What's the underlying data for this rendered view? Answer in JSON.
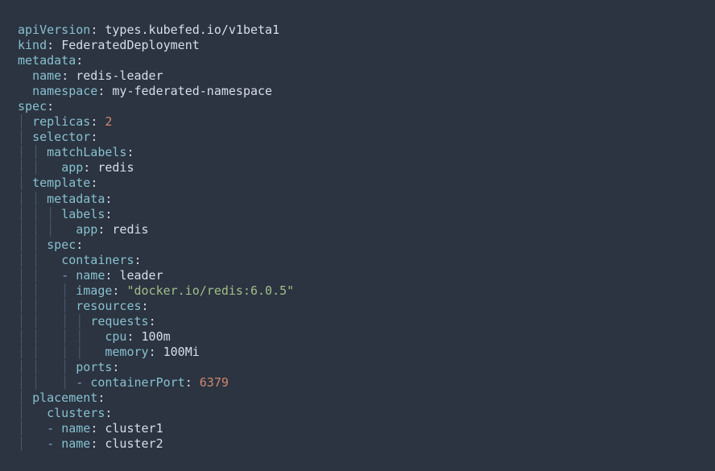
{
  "yaml": {
    "apiVersion": {
      "key": "apiVersion",
      "value": "types.kubefed.io/v1beta1"
    },
    "kind": {
      "key": "kind",
      "value": "FederatedDeployment"
    },
    "metadata": {
      "key": "metadata"
    },
    "metadata_name": {
      "key": "name",
      "value": "redis-leader"
    },
    "metadata_namespace": {
      "key": "namespace",
      "value": "my-federated-namespace"
    },
    "spec": {
      "key": "spec"
    },
    "spec_replicas": {
      "key": "replicas",
      "value": "2"
    },
    "spec_selector": {
      "key": "selector"
    },
    "spec_selector_matchLabels": {
      "key": "matchLabels"
    },
    "spec_selector_matchLabels_app": {
      "key": "app",
      "value": "redis"
    },
    "spec_template": {
      "key": "template"
    },
    "spec_template_metadata": {
      "key": "metadata"
    },
    "spec_template_metadata_labels": {
      "key": "labels"
    },
    "spec_template_metadata_labels_app": {
      "key": "app",
      "value": "redis"
    },
    "spec_template_spec": {
      "key": "spec"
    },
    "spec_template_spec_containers": {
      "key": "containers"
    },
    "container_name": {
      "key": "name",
      "value": "leader"
    },
    "container_image": {
      "key": "image",
      "value": "\"docker.io/redis:6.0.5\""
    },
    "container_resources": {
      "key": "resources"
    },
    "container_resources_requests": {
      "key": "requests"
    },
    "container_resources_requests_cpu": {
      "key": "cpu",
      "value": "100m"
    },
    "container_resources_requests_memory": {
      "key": "memory",
      "value": "100Mi"
    },
    "container_ports": {
      "key": "ports"
    },
    "container_ports_containerPort": {
      "key": "containerPort",
      "value": "6379"
    },
    "spec_placement": {
      "key": "placement"
    },
    "spec_placement_clusters": {
      "key": "clusters"
    },
    "cluster1": {
      "key": "name",
      "value": "cluster1"
    },
    "cluster2": {
      "key": "name",
      "value": "cluster2"
    }
  }
}
